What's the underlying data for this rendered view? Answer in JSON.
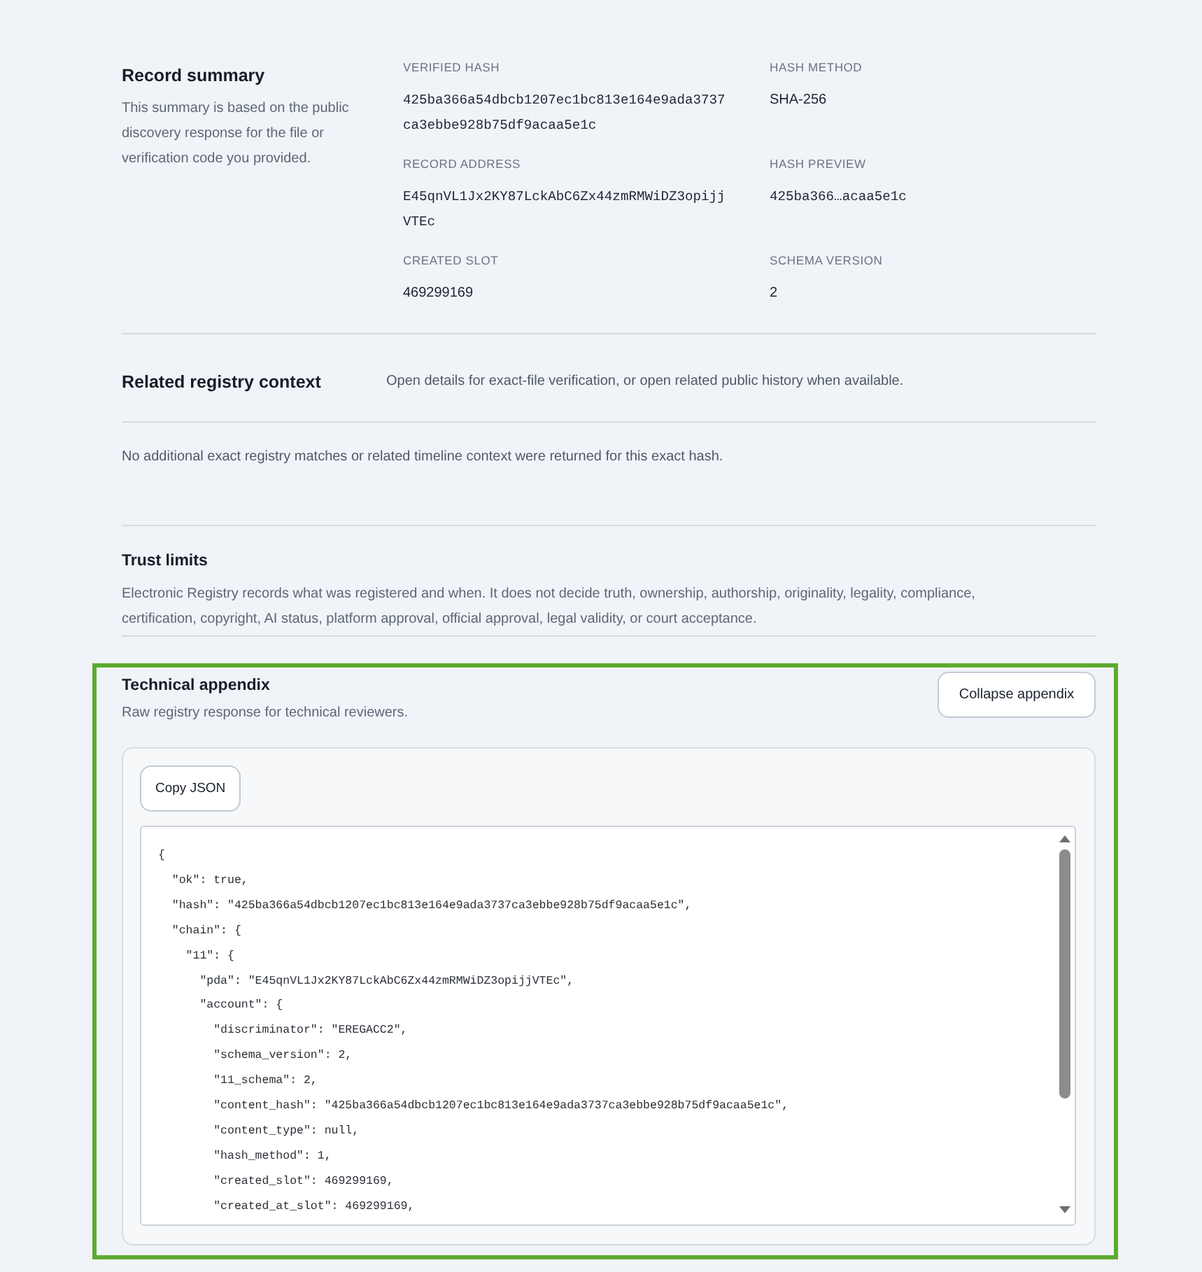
{
  "record_summary": {
    "title": "Record summary",
    "description": "This summary is based on the public discovery response for the file or verification code you provided.",
    "fields": [
      {
        "label": "VERIFIED HASH",
        "value": "425ba366a54dbcb1207ec1bc813e164e9ada3737ca3ebbe928b75df9acaa5e1c",
        "kind": "mono"
      },
      {
        "label": "HASH METHOD",
        "value": "SHA-256",
        "kind": "text"
      },
      {
        "label": "RECORD ADDRESS",
        "value": "E45qnVL1Jx2KY87LckAbC6Zx44zmRMWiDZ3opijjVTEc",
        "kind": "mono"
      },
      {
        "label": "HASH PREVIEW",
        "value": "425ba366…acaa5e1c",
        "kind": "mono"
      },
      {
        "label": "CREATED SLOT",
        "value": "469299169",
        "kind": "text"
      },
      {
        "label": "SCHEMA VERSION",
        "value": "2",
        "kind": "text"
      }
    ]
  },
  "related_context": {
    "title": "Related registry context",
    "description": "Open details for exact-file verification, or open related public history when available.",
    "message": "No additional exact registry matches or related timeline context were returned for this exact hash."
  },
  "trust_limits": {
    "title": "Trust limits",
    "text": "Electronic Registry records what was registered and when. It does not decide truth, ownership, authorship, originality, legality, compliance, certification, copyright, AI status, platform approval, official approval, legal validity, or court acceptance."
  },
  "technical_appendix": {
    "highlighted": true,
    "title": "Technical appendix",
    "subtitle": "Raw registry response for technical reviewers.",
    "collapse_button": "Collapse appendix",
    "copy_button": "Copy JSON",
    "code_lines": [
      "{",
      "  \"ok\": true,",
      "  \"hash\": \"425ba366a54dbcb1207ec1bc813e164e9ada3737ca3ebbe928b75df9acaa5e1c\",",
      "  \"chain\": {",
      "    \"11\": {",
      "      \"pda\": \"E45qnVL1Jx2KY87LckAbC6Zx44zmRMWiDZ3opijjVTEc\",",
      "      \"account\": {",
      "        \"discriminator\": \"EREGACC2\",",
      "        \"schema_version\": 2,",
      "        \"11_schema\": 2,",
      "        \"content_hash\": \"425ba366a54dbcb1207ec1bc813e164e9ada3737ca3ebbe928b75df9acaa5e1c\",",
      "        \"content_type\": null,",
      "        \"hash_method\": 1,",
      "        \"created_slot\": 469299169,",
      "        \"created_at_slot\": 469299169,"
    ]
  }
}
